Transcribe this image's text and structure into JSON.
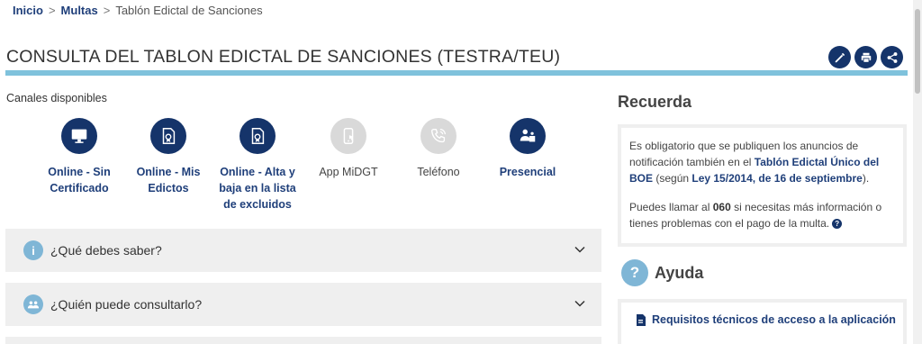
{
  "breadcrumb": {
    "home": "Inicio",
    "section": "Multas",
    "current": "Tablón Edictal de Sanciones",
    "separator": ">"
  },
  "page_title": "CONSULTA DEL TABLON EDICTAL DE SANCIONES (TESTRA/TEU)",
  "actions": [
    {
      "name": "edit-button",
      "icon": "pencil-icon"
    },
    {
      "name": "print-button",
      "icon": "printer-icon"
    },
    {
      "name": "share-button",
      "icon": "share-icon"
    }
  ],
  "channels_label": "Canales disponibles",
  "channels": [
    {
      "label": "Online - Sin Certificado",
      "icon": "monitor-icon",
      "enabled": true
    },
    {
      "label": "Online - Mis Edictos",
      "icon": "document-certificate-icon",
      "enabled": true
    },
    {
      "label": "Online - Alta y baja en la lista de excluidos",
      "icon": "document-certificate-icon",
      "enabled": true
    },
    {
      "label": "App MiDGT",
      "icon": "mobile-app-icon",
      "enabled": false
    },
    {
      "label": "Teléfono",
      "icon": "phone-icon",
      "enabled": false
    },
    {
      "label": "Presencial",
      "icon": "person-desk-icon",
      "enabled": true
    }
  ],
  "accordions": [
    {
      "title": "¿Qué debes saber?",
      "icon": "info-icon"
    },
    {
      "title": "¿Quién puede consultarlo?",
      "icon": "people-icon"
    }
  ],
  "recuerda": {
    "title": "Recuerda",
    "p1_a": "Es obligatorio que se publiquen los anuncios de notificación también en el ",
    "p1_link": "Tablón Edictal Único del BOE",
    "p1_b": " (según ",
    "p1_law": "Ley 15/2014, de 16 de septiembre",
    "p1_c": ").",
    "p2_a": "Puedes llamar al ",
    "p2_phone": "060",
    "p2_b": " si necesitas más información o tienes problemas con el pago de la multa."
  },
  "ayuda": {
    "title": "Ayuda",
    "link": "Requisitos técnicos de acceso a la aplicación"
  },
  "colors": {
    "primary_navy": "#15346a",
    "link_blue": "#1f3f7a",
    "accent_light_blue": "#7fc2dc",
    "disabled_gray": "#d9d9d9",
    "panel_gray": "#efefef"
  }
}
